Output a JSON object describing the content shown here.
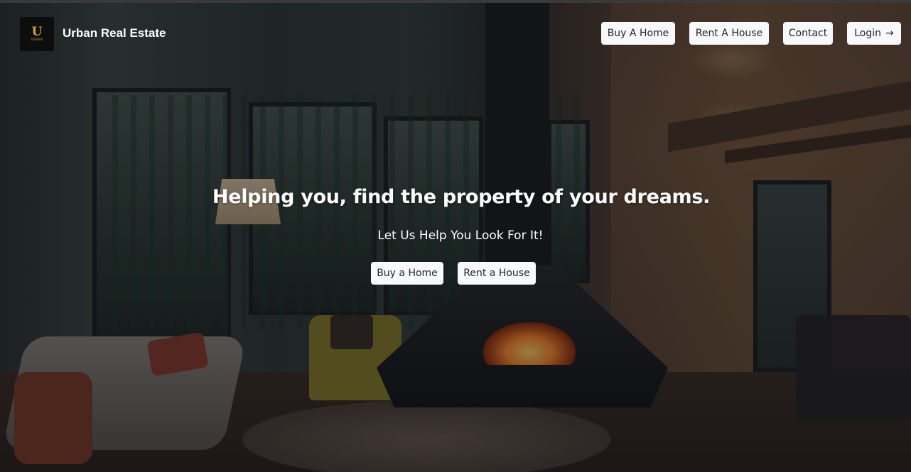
{
  "brand": {
    "name": "Urban Real Estate",
    "logo_mark": "U",
    "logo_sub": "URBAN"
  },
  "nav": {
    "buy_label": "Buy A Home",
    "rent_label": "Rent A House",
    "contact_label": "Contact",
    "login_label": "Login",
    "login_icon": "arrow-right-icon",
    "login_glyph": "→"
  },
  "hero": {
    "headline": "Helping you, find the property of your dreams.",
    "subline": "Let Us Help You Look For It!",
    "buy_cta": "Buy a Home",
    "rent_cta": "Rent a House"
  },
  "colors": {
    "button_bg": "#f8f9fa",
    "button_text": "#212529",
    "logo_gold": "#c9a43a",
    "hero_text": "#ffffff"
  }
}
